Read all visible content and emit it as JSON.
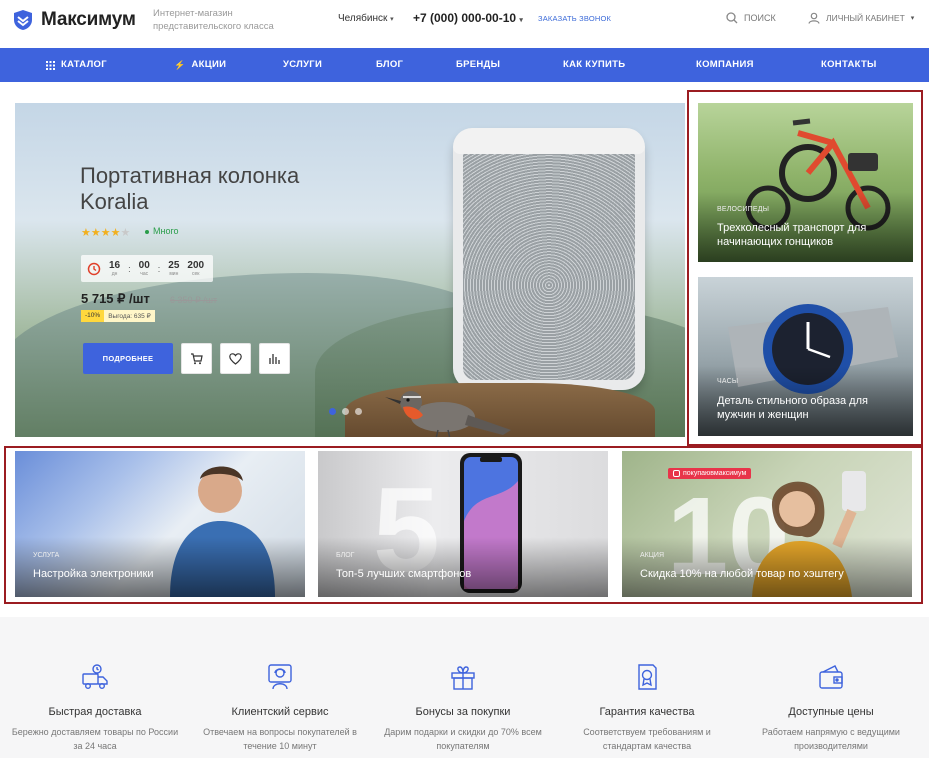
{
  "header": {
    "logo_text": "Максимум",
    "tagline": "Интернет-магазин представительского класса",
    "city": "Челябинск",
    "phone": "+7 (000) 000-00-10",
    "callback": "ЗАКАЗАТЬ ЗВОНОК",
    "search": "ПОИСК",
    "cabinet": "ЛИЧНЫЙ КАБИНЕТ"
  },
  "nav": [
    "КАТАЛОГ",
    "АКЦИИ",
    "УСЛУГИ",
    "БЛОГ",
    "БРЕНДЫ",
    "КАК КУПИТЬ",
    "КОМПАНИЯ",
    "КОНТАКТЫ"
  ],
  "hero": {
    "title_line1": "Портативная колонка",
    "title_line2": "Koralia",
    "rating": 4,
    "stock": "Много",
    "timer": {
      "days": "16",
      "days_label": "дн",
      "hours": "00",
      "hours_label": "час",
      "minutes": "25",
      "minutes_label": "мин",
      "seconds": "200",
      "seconds_label": "сек"
    },
    "price": "5 715 ₽ /шт",
    "old_price": "6 350 ₽ /шт",
    "discount_pct": "-10%",
    "discount_save": "Выгода: 635 ₽",
    "button": "ПОДРОБНЕЕ",
    "slides": 3,
    "active_slide": 1
  },
  "side_banners": [
    {
      "tag": "ВЕЛОСИПЕДЫ",
      "caption": "Трехколесный транспорт для начинающих гонщиков"
    },
    {
      "tag": "ЧАСЫ",
      "caption": "Деталь стильного образа для мужчин и женщин"
    }
  ],
  "bottom_banners": [
    {
      "tag": "УСЛУГА",
      "caption": "Настройка электроники"
    },
    {
      "tag": "БЛОГ",
      "caption": "Топ-5 лучших смартфонов"
    },
    {
      "tag": "АКЦИЯ",
      "caption": "Скидка 10% на любой товар по хэштегу",
      "badge": "покупаювмаксимум"
    }
  ],
  "features": [
    {
      "icon": "delivery-truck-icon",
      "title": "Быстрая доставка",
      "desc": "Бережно доставляем товары по России за 24 часа"
    },
    {
      "icon": "customer-service-icon",
      "title": "Клиентский сервис",
      "desc": "Отвечаем на вопросы покупателей в течение 10 минут"
    },
    {
      "icon": "gift-icon",
      "title": "Бонусы за покупки",
      "desc": "Дарим подарки и скидки до 70% всем покупателям"
    },
    {
      "icon": "quality-certificate-icon",
      "title": "Гарантия качества",
      "desc": "Соответствуем требованиям и стандартам качества"
    },
    {
      "icon": "wallet-icon",
      "title": "Доступные цены",
      "desc": "Работаем напрямую с ведущими производителями"
    }
  ],
  "colors": {
    "accent": "#3e63dd",
    "highlight_frame": "#9b1c21",
    "stock": "#2a9d4a",
    "star": "#f2b01e"
  }
}
